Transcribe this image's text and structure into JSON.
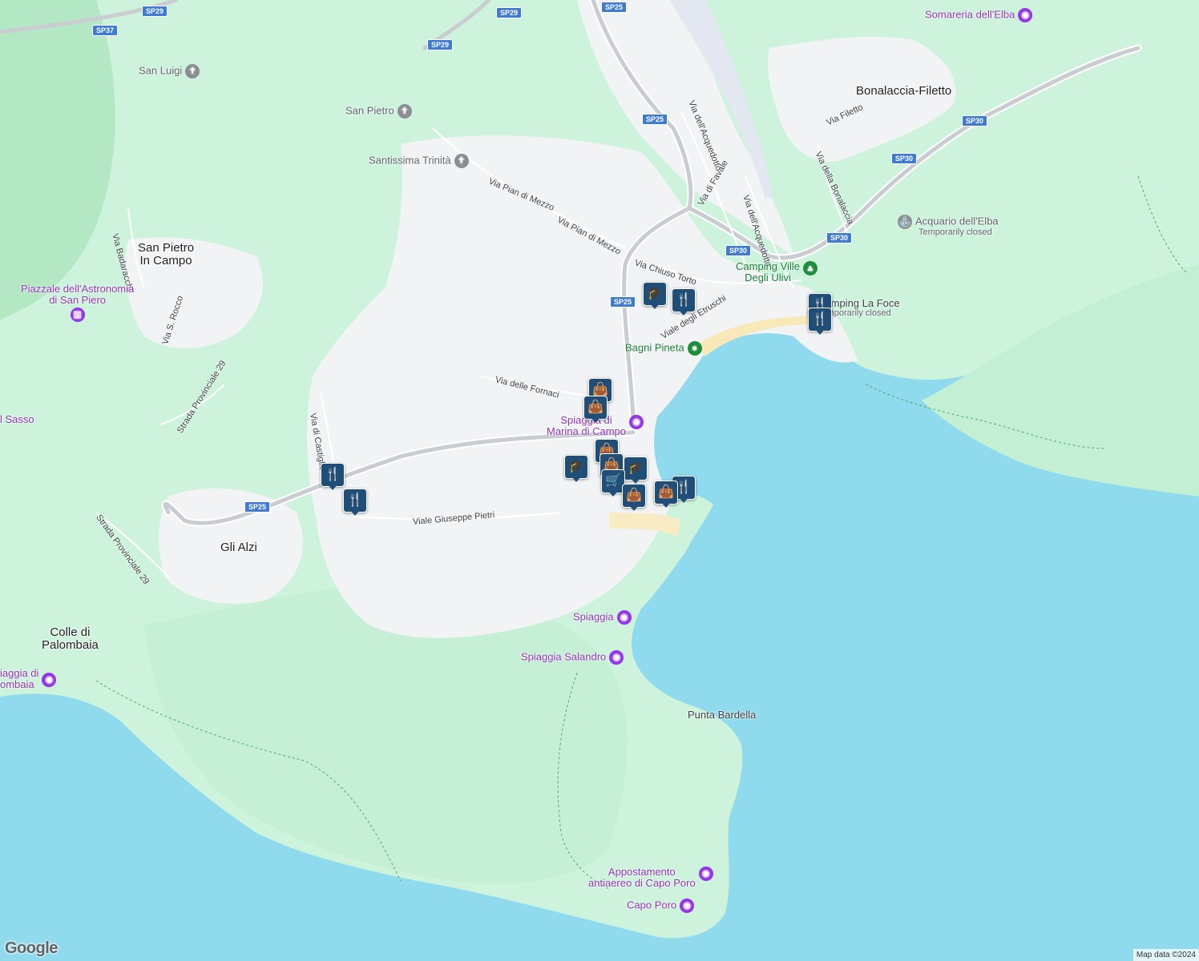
{
  "colors": {
    "sea": "#8fdaec",
    "land": "#cdf3dc",
    "urban": "#f1f3f4",
    "road": "#c9ccd1",
    "pin": "#1f4f78"
  },
  "towns": [
    {
      "id": "bonalaccia",
      "name": "Bonalaccia-Filetto"
    },
    {
      "id": "san-pietro",
      "name": "San Pietro\nIn Campo"
    },
    {
      "id": "gli-alzi",
      "name": "Gli Alzi"
    },
    {
      "id": "colle",
      "name": "Colle di\nPalombaia"
    },
    {
      "id": "sasso",
      "name": "l Sasso"
    }
  ],
  "pois": [
    {
      "id": "somareria",
      "name": "Somareria dell'Elba",
      "icon": "camera-icon",
      "color": "purple"
    },
    {
      "id": "san-luigi",
      "name": "San Luigi",
      "icon": "church-icon",
      "color": "gray"
    },
    {
      "id": "san-pietro-ch",
      "name": "San Pietro",
      "icon": "church-icon",
      "color": "gray"
    },
    {
      "id": "trinita",
      "name": "Santissima Trinità",
      "icon": "church-icon",
      "color": "gray"
    },
    {
      "id": "acquario",
      "name": "Acquario dell'Elba",
      "sub": "Temporarily closed",
      "icon": "aquarium-icon",
      "color": "gray"
    },
    {
      "id": "camping-ulivi",
      "name": "Camping Ville\nDegli Ulivi",
      "icon": "camping-icon",
      "color": "green"
    },
    {
      "id": "camping-foce",
      "name": "Camping La Foce",
      "sub": "Temporarily closed",
      "icon": "camping-icon",
      "color": "gray"
    },
    {
      "id": "bagni",
      "name": "Bagni Pineta",
      "icon": "place-icon",
      "color": "green"
    },
    {
      "id": "piazzale",
      "name": "Piazzale dell'Astronomia\ndi San Piero",
      "icon": "museum-icon",
      "color": "purple"
    },
    {
      "id": "marina",
      "name": "Spiaggia di\nMarina di Campo",
      "icon": "camera-icon",
      "color": "purple"
    },
    {
      "id": "spiaggia",
      "name": "Spiaggia",
      "icon": "camera-icon",
      "color": "purple"
    },
    {
      "id": "salandro",
      "name": "Spiaggia Salandro",
      "icon": "camera-icon",
      "color": "purple"
    },
    {
      "id": "punta",
      "name": "Punta Bardella",
      "icon": "",
      "color": "gray"
    },
    {
      "id": "appostamento",
      "name": "Appostamento\nantiaereo di Capo Poro",
      "icon": "camera-icon",
      "color": "purple"
    },
    {
      "id": "capo-poro",
      "name": "Capo Poro",
      "icon": "camera-icon",
      "color": "purple"
    },
    {
      "id": "palombaia",
      "name": "iaggia di\nombaia",
      "icon": "camera-icon",
      "color": "purple"
    }
  ],
  "roads": [
    {
      "id": "pian1",
      "name": "Via Pian di Mezzo"
    },
    {
      "id": "pian2",
      "name": "Via Pian di Mezzo"
    },
    {
      "id": "chiuso",
      "name": "Via Chiuso Torto"
    },
    {
      "id": "etruschi",
      "name": "Viale degli Etruschi"
    },
    {
      "id": "fornaci",
      "name": "Via delle Fornaci"
    },
    {
      "id": "pietri",
      "name": "Viale Giuseppe Pietri"
    },
    {
      "id": "castiglione",
      "name": "Via di Castiglione"
    },
    {
      "id": "strada29a",
      "name": "Strada Provinciale 29"
    },
    {
      "id": "strada29b",
      "name": "Strada Provinciale 29"
    },
    {
      "id": "badaracchi",
      "name": "Via Badaracchi"
    },
    {
      "id": "srocco",
      "name": "Via S. Rocco"
    },
    {
      "id": "acquedotto1",
      "name": "Via dell'Acquedotto"
    },
    {
      "id": "acquedotto2",
      "name": "Via dell'Acquedotto"
    },
    {
      "id": "favale",
      "name": "Via di Favale"
    },
    {
      "id": "filetto",
      "name": "Via Filetto"
    },
    {
      "id": "bonalaccia-rd",
      "name": "Via della Bonalaccia"
    }
  ],
  "shields": [
    {
      "id": "s1",
      "label": "SP29"
    },
    {
      "id": "s2",
      "label": "SP29"
    },
    {
      "id": "s3",
      "label": "SP29"
    },
    {
      "id": "s4",
      "label": "SP37"
    },
    {
      "id": "s5",
      "label": "SP25"
    },
    {
      "id": "s6",
      "label": "SP25"
    },
    {
      "id": "s7",
      "label": "SP25"
    },
    {
      "id": "s8",
      "label": "SP25"
    },
    {
      "id": "s9",
      "label": "SP30"
    },
    {
      "id": "s10",
      "label": "SP30"
    },
    {
      "id": "s11",
      "label": "SP30"
    },
    {
      "id": "s12",
      "label": "SP30"
    }
  ],
  "markers": [
    {
      "id": "m1",
      "type": "school"
    },
    {
      "id": "m2",
      "type": "restaurant"
    },
    {
      "id": "m3",
      "type": "restaurant"
    },
    {
      "id": "m4",
      "type": "restaurant"
    },
    {
      "id": "m5",
      "type": "shopping"
    },
    {
      "id": "m6",
      "type": "shopping"
    },
    {
      "id": "m7",
      "type": "school"
    },
    {
      "id": "m8",
      "type": "shopping"
    },
    {
      "id": "m9",
      "type": "shopping"
    },
    {
      "id": "m10",
      "type": "school"
    },
    {
      "id": "m11",
      "type": "shopping"
    },
    {
      "id": "m12",
      "type": "restaurant"
    },
    {
      "id": "m13",
      "type": "shopping"
    },
    {
      "id": "m14",
      "type": "shopping"
    },
    {
      "id": "m15",
      "type": "restaurant"
    },
    {
      "id": "m16",
      "type": "restaurant"
    },
    {
      "id": "m17",
      "type": "restaurant"
    },
    {
      "id": "m18",
      "type": "restaurant"
    }
  ],
  "footer": {
    "logo": "Google",
    "attribution": "Map data ©2024"
  }
}
